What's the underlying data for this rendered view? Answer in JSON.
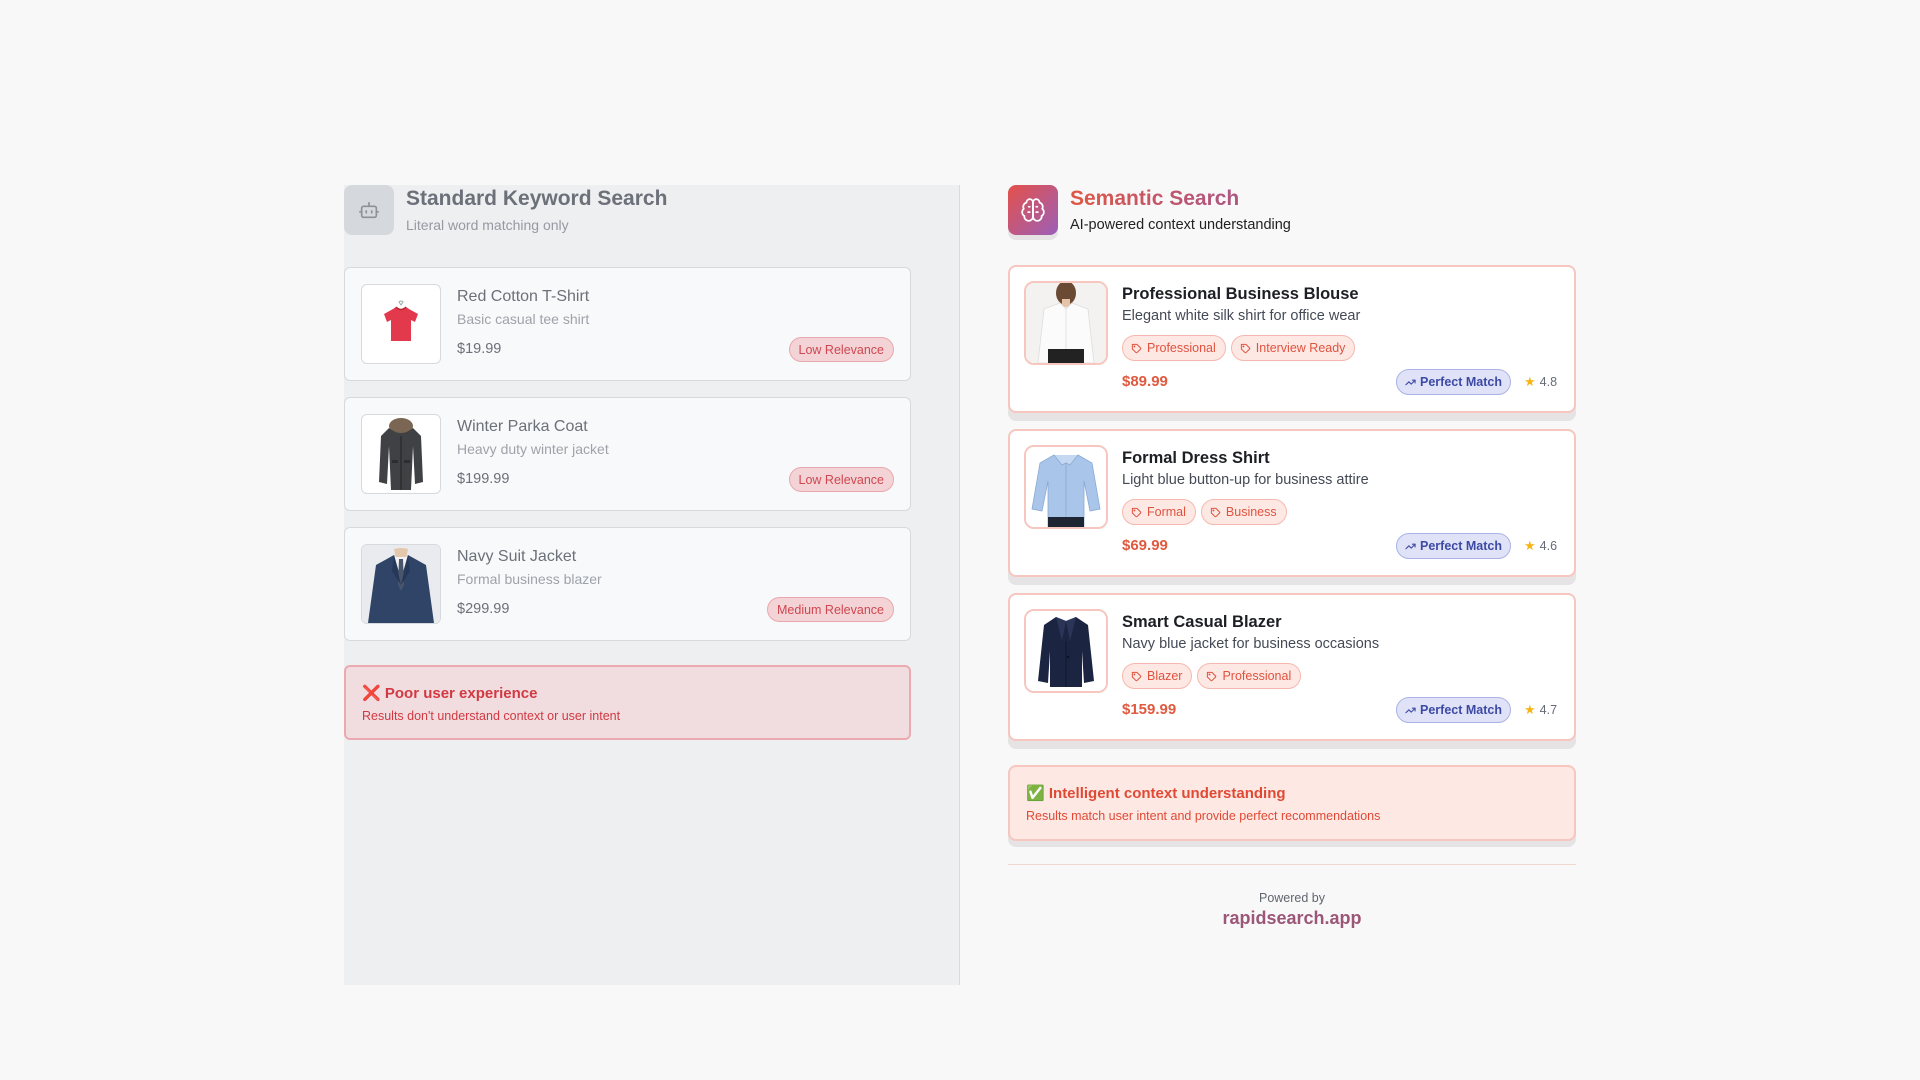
{
  "keyword_panel": {
    "title": "Standard Keyword Search",
    "subtitle": "Literal word matching only",
    "icon": "robot-icon",
    "results": [
      {
        "name": "Red Cotton T-Shirt",
        "description": "Basic casual tee shirt",
        "price": "$19.99",
        "relevance": "Low Relevance",
        "image": "red-tshirt-image"
      },
      {
        "name": "Winter Parka Coat",
        "description": "Heavy duty winter jacket",
        "price": "$199.99",
        "relevance": "Low Relevance",
        "image": "parka-coat-image"
      },
      {
        "name": "Navy Suit Jacket",
        "description": "Formal business blazer",
        "price": "$299.99",
        "relevance": "Medium Relevance",
        "image": "suit-jacket-image"
      }
    ],
    "alert": {
      "title": "Poor user experience",
      "text": "Results don't understand context or user intent",
      "icon": "x-mark-icon",
      "glyph": "❌"
    }
  },
  "semantic_panel": {
    "title": "Semantic Search",
    "subtitle": "AI-powered context understanding",
    "icon": "brain-icon",
    "results": [
      {
        "name": "Professional Business Blouse",
        "description": "Elegant white silk shirt for office wear",
        "tags": [
          "Professional",
          "Interview Ready"
        ],
        "price": "$89.99",
        "match": "Perfect Match",
        "rating": "4.8",
        "image": "blouse-image"
      },
      {
        "name": "Formal Dress Shirt",
        "description": "Light blue button-up for business attire",
        "tags": [
          "Formal",
          "Business"
        ],
        "price": "$69.99",
        "match": "Perfect Match",
        "rating": "4.6",
        "image": "dress-shirt-image"
      },
      {
        "name": "Smart Casual Blazer",
        "description": "Navy blue jacket for business occasions",
        "tags": [
          "Blazer",
          "Professional"
        ],
        "price": "$159.99",
        "match": "Perfect Match",
        "rating": "4.7",
        "image": "blazer-image"
      }
    ],
    "alert": {
      "title": "Intelligent context understanding",
      "text": "Results match user intent and provide perfect recommendations",
      "icon": "check-mark-icon",
      "glyph": "✅"
    }
  },
  "footer": {
    "powered_by": "Powered by",
    "brand": "rapidsearch.app"
  },
  "colors": {
    "accent": "#e05a40",
    "brand_purple": "#9b5678",
    "match_blue": "#3d4aa3",
    "error_red": "#d13a42",
    "star": "#f4b515"
  }
}
